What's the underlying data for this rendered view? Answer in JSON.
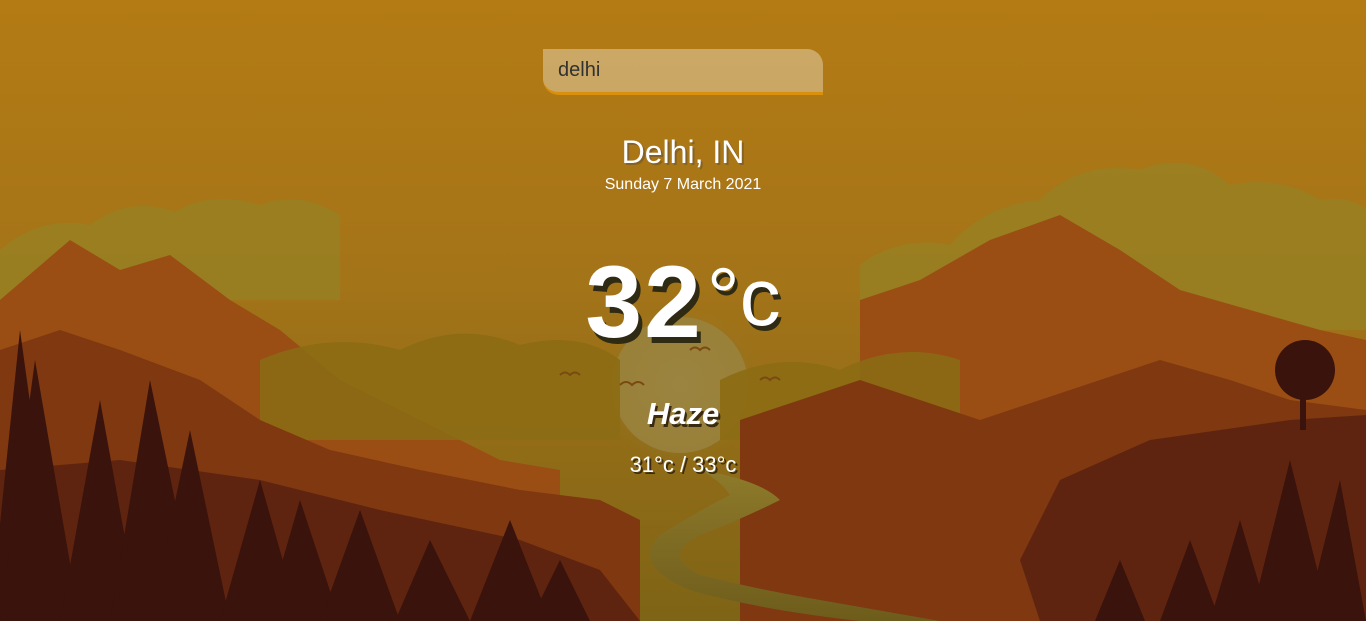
{
  "search": {
    "value": "delhi"
  },
  "location": {
    "name": "Delhi, IN",
    "date": "Sunday 7 March 2021"
  },
  "weather": {
    "temperature": "32",
    "unit": "°c",
    "condition": "Haze",
    "range": "31°c / 33°c"
  },
  "colors": {
    "sky_top": "#b37a14",
    "sky_bottom": "#8a6a18",
    "accent": "#d9900c",
    "mountain": "#8a3e12",
    "forest": "#3a130c"
  }
}
